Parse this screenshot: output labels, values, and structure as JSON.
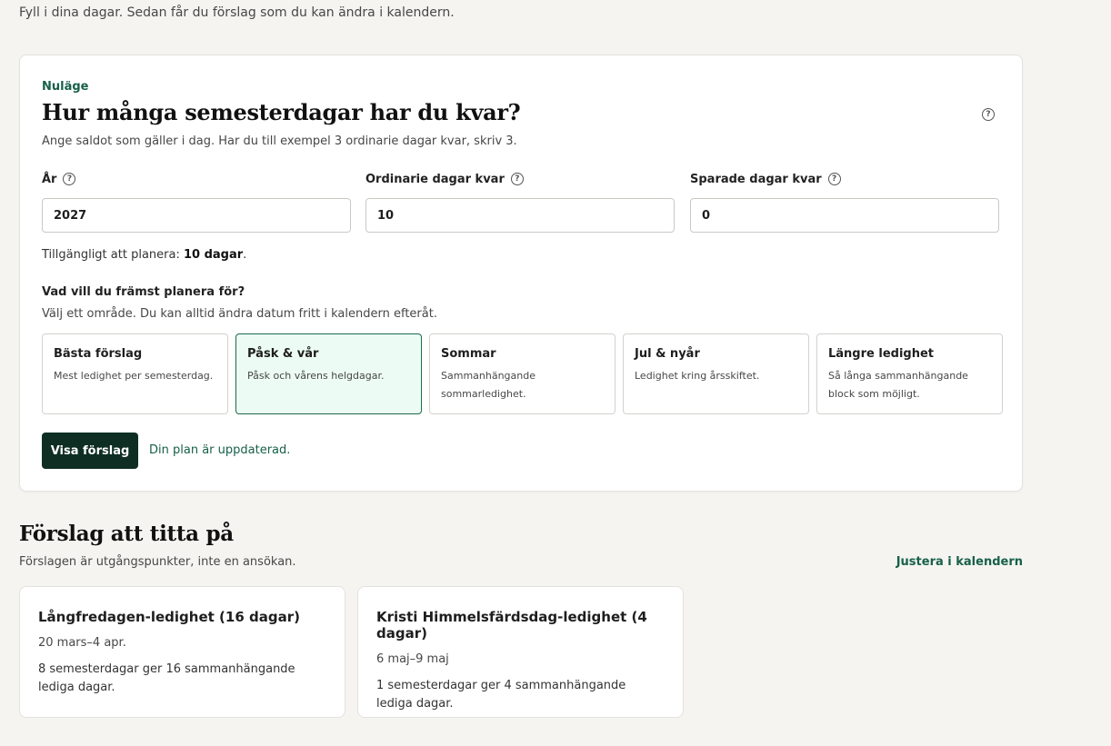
{
  "intro": "Fyll i dina dagar. Sedan får du förslag som du kan ändra i kalendern.",
  "current": {
    "eyebrow": "Nuläge",
    "title": "Hur många semesterdagar har du kvar?",
    "subtitle": "Ange saldot som gäller i dag. Har du till exempel 3 ordinarie dagar kvar, skriv 3.",
    "help_glyph": "?",
    "fields": [
      {
        "label": "År",
        "value": "2027"
      },
      {
        "label": "Ordinarie dagar kvar",
        "value": "10"
      },
      {
        "label": "Sparade dagar kvar",
        "value": "0"
      }
    ],
    "available_prefix": "Tillgängligt att planera: ",
    "available_value": "10 dagar",
    "available_suffix": ".",
    "question": "Vad vill du främst planera för?",
    "question_sub": "Välj ett område. Du kan alltid ändra datum fritt i kalendern efteråt.",
    "options": [
      {
        "title": "Bästa förslag",
        "desc": "Mest ledighet per semesterdag."
      },
      {
        "title": "Påsk & vår",
        "desc": "Påsk och vårens helgdagar."
      },
      {
        "title": "Sommar",
        "desc": "Sammanhängande sommarledighet."
      },
      {
        "title": "Jul & nyår",
        "desc": "Ledighet kring årsskiftet."
      },
      {
        "title": "Längre ledighet",
        "desc": "Så långa sammanhängande block som möjligt."
      }
    ],
    "selected_option": "Påsk & vår",
    "show_button": "Visa förslag",
    "status": "Din plan är uppdaterad."
  },
  "suggestions": {
    "title": "Förslag att titta på",
    "subtitle": "Förslagen är utgångspunkter, inte en ansökan.",
    "adjust_link": "Justera i kalendern",
    "items": [
      {
        "title": "Långfredagen-ledighet (16 dagar)",
        "dates": "20 mars–4 apr.",
        "desc": "8 semesterdagar ger 16 sammanhängande lediga dagar."
      },
      {
        "title": "Kristi Himmelsfärdsdag-ledighet (4 dagar)",
        "dates": "6 maj–9 maj",
        "desc": "1 semesterdagar ger 4 sammanhängande lediga dagar."
      }
    ]
  },
  "colors": {
    "accent_green": "#17604a",
    "button_dark": "#0e2e24",
    "selected_bg": "#ecfbf3"
  },
  "icons": {
    "help": "question-circle-icon"
  }
}
